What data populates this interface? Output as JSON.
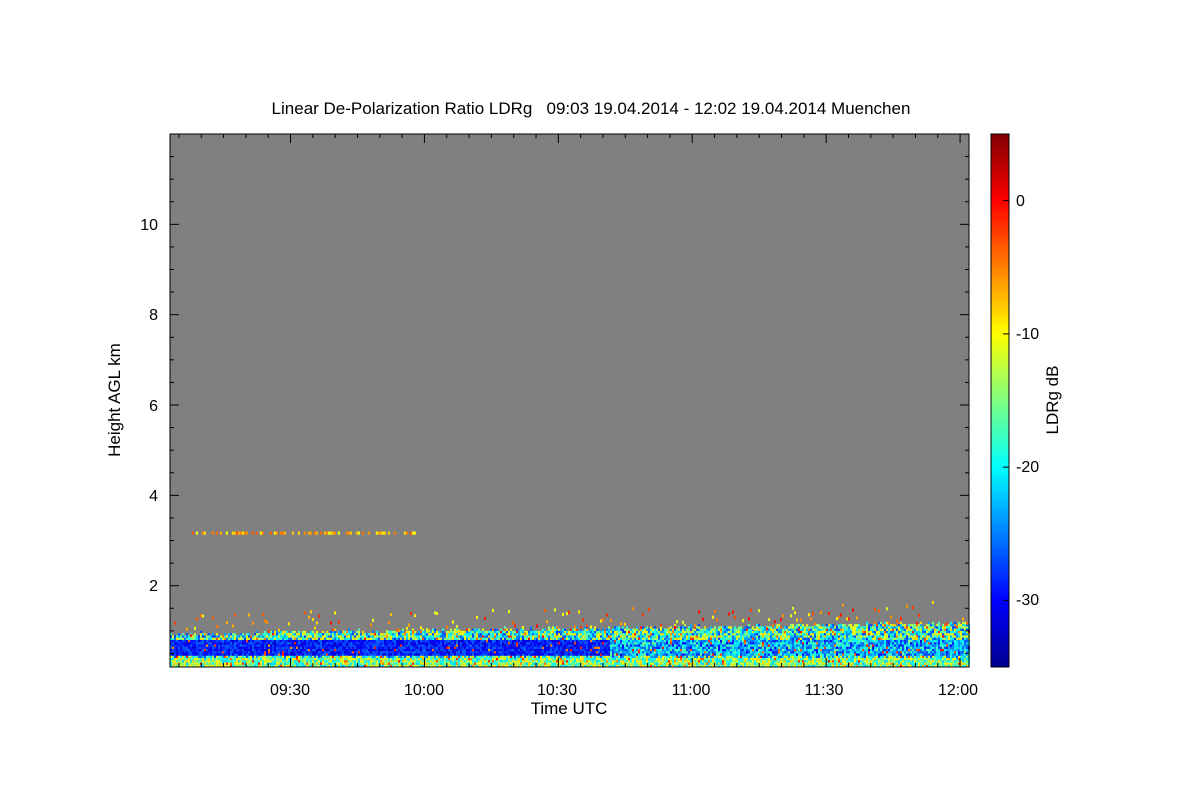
{
  "chart_data": {
    "type": "heatmap",
    "title": "Linear De-Polarization Ratio LDRg   09:03 19.04.2014 - 12:02 19.04.2014 Muenchen",
    "xlabel": "Time UTC",
    "ylabel": "Height AGL km",
    "colorbar_label": "LDRg dB",
    "x_range": [
      "09:03",
      "12:02"
    ],
    "x_ticks": [
      "09:30",
      "10:00",
      "10:30",
      "11:00",
      "11:30",
      "12:00"
    ],
    "y_range_km": [
      0.2,
      12.0
    ],
    "y_ticks": [
      "2",
      "4",
      "6",
      "8",
      "10"
    ],
    "y_tick_values": [
      2,
      4,
      6,
      8,
      10
    ],
    "colorbar_range_db": [
      -35,
      5
    ],
    "colorbar_ticks": [
      "0",
      "-10",
      "-20",
      "-30"
    ],
    "colorbar_tick_values": [
      0,
      -10,
      -20,
      -30
    ],
    "no_signal_color": "#808080",
    "colormap": "jet",
    "features": [
      {
        "name": "boundary-layer",
        "time_start": "09:03",
        "time_end": "12:02",
        "height_km": [
          0.2,
          1.0
        ],
        "ldr_db": -30
      },
      {
        "name": "aerosol-layer",
        "time_start": "09:07",
        "time_end": "09:58",
        "height_km": [
          3.15,
          3.2
        ],
        "ldr_db": -5
      }
    ]
  }
}
